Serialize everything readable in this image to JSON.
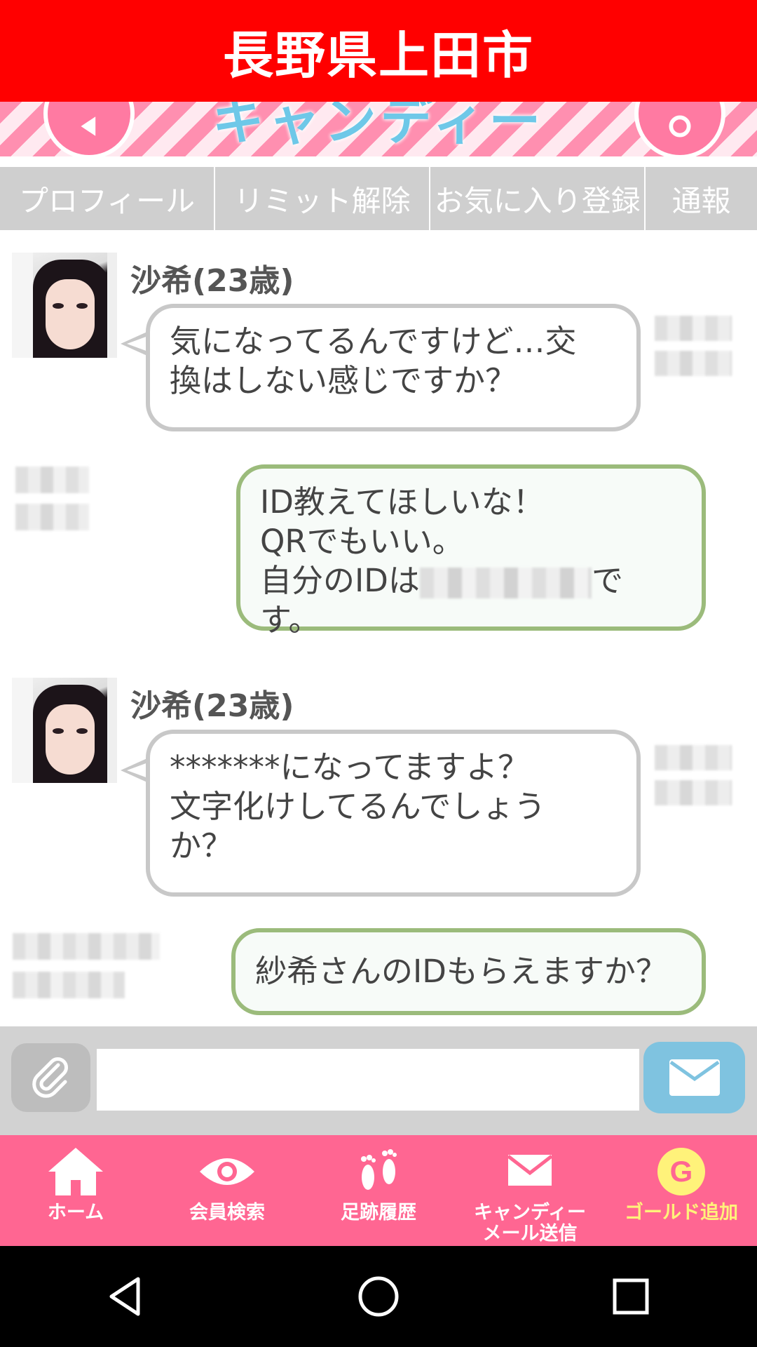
{
  "header": {
    "title": "長野県上田市"
  },
  "banner": {
    "logo": "キャンディー"
  },
  "tabs": [
    {
      "label": "プロフィール"
    },
    {
      "label": "リミット解除"
    },
    {
      "label": "お気に入り登録"
    },
    {
      "label": "通報"
    }
  ],
  "messages": [
    {
      "direction": "in",
      "sender": "沙希(23歳)",
      "text": "気になってるんですけど…交\n換はしない感じですか？"
    },
    {
      "direction": "out",
      "line1": "ID教えてほしいな！",
      "line2": "QRでもいい。",
      "line3_prefix": "自分のIDは",
      "line3_suffix": "です。"
    },
    {
      "direction": "in",
      "sender": "沙希(23歳)",
      "text": "*******になってますよ？\n文字化けしてるんでしょう\nか？"
    },
    {
      "direction": "out",
      "text": "紗希さんのIDもらえますか？"
    }
  ],
  "composer": {
    "value": "",
    "placeholder": ""
  },
  "nav": [
    {
      "label": "ホーム",
      "icon": "home-icon"
    },
    {
      "label": "会員検索",
      "icon": "eye-icon"
    },
    {
      "label": "足跡履歴",
      "icon": "footprints-icon"
    },
    {
      "label": "キャンディー\nメール送信",
      "icon": "mail-icon"
    },
    {
      "label": "ゴールド追加",
      "icon": "gold-icon"
    }
  ],
  "colors": {
    "header": "#ff0000",
    "nav": "#ff6692",
    "out_border": "#9bbb7b",
    "in_border": "#c8c8c8",
    "send_button": "#7fc3e0",
    "gold": "#fff27a"
  }
}
